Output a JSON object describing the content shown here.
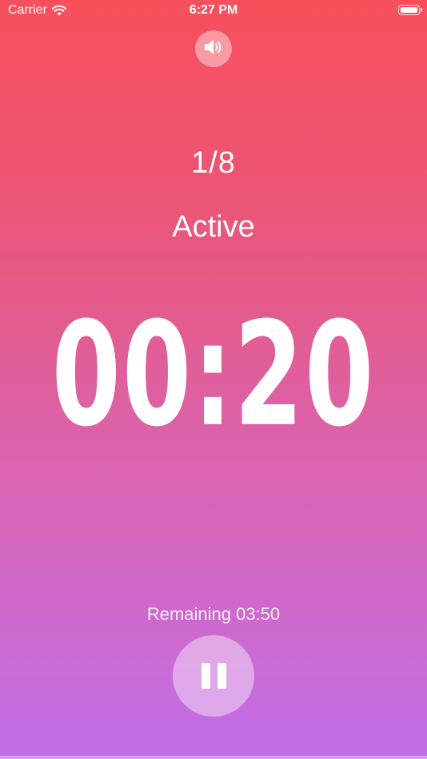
{
  "status_bar": {
    "carrier": "Carrier",
    "time": "6:27 PM",
    "icons": [
      "wifi-icon",
      "battery-icon"
    ]
  },
  "sound": {
    "icon": "speaker-icon",
    "state": "on"
  },
  "workout": {
    "round": "1/8",
    "phase": "Active",
    "timer": "00:20",
    "remaining": "Remaining 03:50"
  },
  "controls": {
    "pause_icon": "pause-icon"
  },
  "colors": {
    "gradient_top": "#f84f5c",
    "gradient_bottom": "#c26ee8",
    "text": "#ffffff"
  }
}
